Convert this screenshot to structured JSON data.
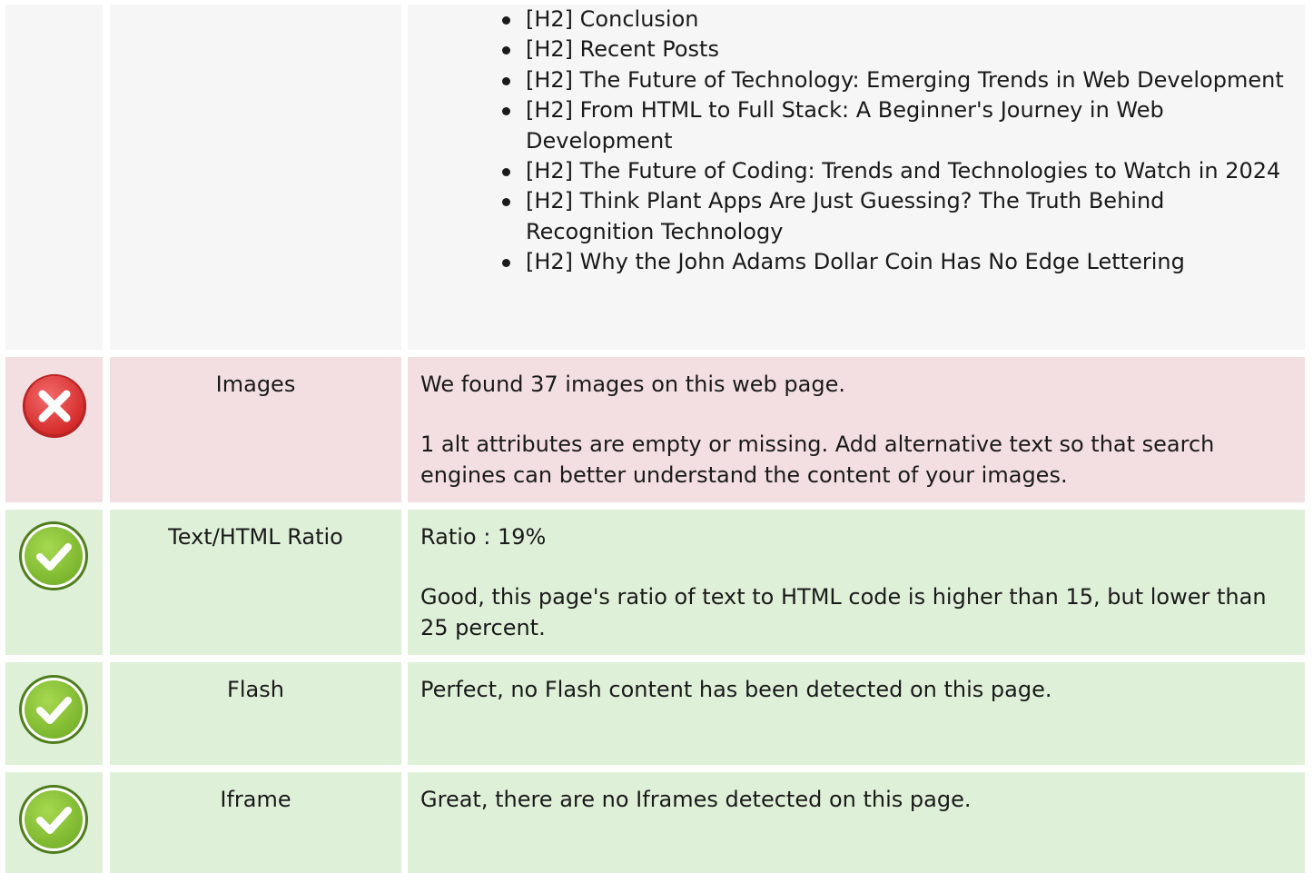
{
  "headings_row": {
    "items": [
      "[H2] Conclusion",
      "[H2] Recent Posts",
      "[H2] The Future of Technology: Emerging Trends in Web Development",
      "[H2] From HTML to Full Stack: A Beginner's Journey in Web Development",
      "[H2] The Future of Coding: Trends and Technologies to Watch in 2024",
      "[H2] Think Plant Apps Are Just Guessing? The Truth Behind Recognition Technology",
      "[H2] Why the John Adams Dollar Coin Has No Edge Lettering"
    ]
  },
  "checks": [
    {
      "status": "fail",
      "icon": "error-x-icon",
      "label": "Images",
      "paragraphs": [
        "We found 37 images on this web page.",
        "1 alt attributes are empty or missing. Add alternative text so that search engines can better understand the content of your images."
      ]
    },
    {
      "status": "pass",
      "icon": "checkmark-icon",
      "label": "Text/HTML Ratio",
      "paragraphs": [
        "Ratio : 19%",
        "Good, this page's ratio of text to HTML code is higher than 15, but lower than 25 percent."
      ]
    },
    {
      "status": "pass",
      "icon": "checkmark-icon",
      "label": "Flash",
      "paragraphs": [
        "Perfect, no Flash content has been detected on this page."
      ]
    },
    {
      "status": "pass",
      "icon": "checkmark-icon",
      "label": "Iframe",
      "paragraphs": [
        "Great, there are no Iframes detected on this page."
      ]
    }
  ],
  "colors": {
    "fail_row": "#f3dfe1",
    "pass_row": "#dff0d8",
    "neutral_row": "#f6f6f6",
    "fail_icon": "#e03a3a",
    "pass_icon": "#8cc63e"
  }
}
